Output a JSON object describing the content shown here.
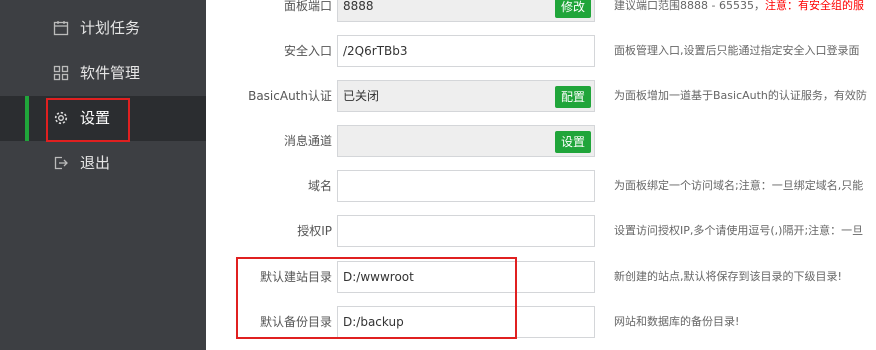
{
  "sidebar": {
    "items": [
      {
        "label": "计划任务",
        "icon": "calendar-icon"
      },
      {
        "label": "软件管理",
        "icon": "grid-icon"
      },
      {
        "label": "设置",
        "icon": "gear-icon"
      },
      {
        "label": "退出",
        "icon": "logout-icon"
      }
    ]
  },
  "settings": {
    "port": {
      "label": "面板端口",
      "value": "8888",
      "button": "修改",
      "desc": "建议端口范围8888 - 65535，",
      "desc_warn": "注意：有安全组的服"
    },
    "entry": {
      "label": "安全入口",
      "value": "/2Q6rTBb3",
      "desc": "面板管理入口,设置后只能通过指定安全入口登录面"
    },
    "basicauth": {
      "label": "BasicAuth认证",
      "value": "已关闭",
      "button": "配置",
      "desc": "为面板增加一道基于BasicAuth的认证服务，有效防"
    },
    "message": {
      "label": "消息通道",
      "value": "",
      "button": "设置"
    },
    "domain": {
      "label": "域名",
      "value": "",
      "desc": "为面板绑定一个访问域名;注意：一旦绑定域名,只能"
    },
    "authip": {
      "label": "授权IP",
      "value": "",
      "desc": "设置访问授权IP,多个请使用逗号(,)隔开;注意：一旦"
    },
    "sitedir": {
      "label": "默认建站目录",
      "value": "D:/wwwroot",
      "desc": "新创建的站点,默认将保存到该目录的下级目录!"
    },
    "backupdir": {
      "label": "默认备份目录",
      "value": "D:/backup",
      "desc": "网站和数据库的备份目录!"
    }
  },
  "colors": {
    "accent": "#20a53a",
    "sidebar_bg": "#3d3f43",
    "highlight": "#e02020",
    "warn": "#ff0000"
  }
}
